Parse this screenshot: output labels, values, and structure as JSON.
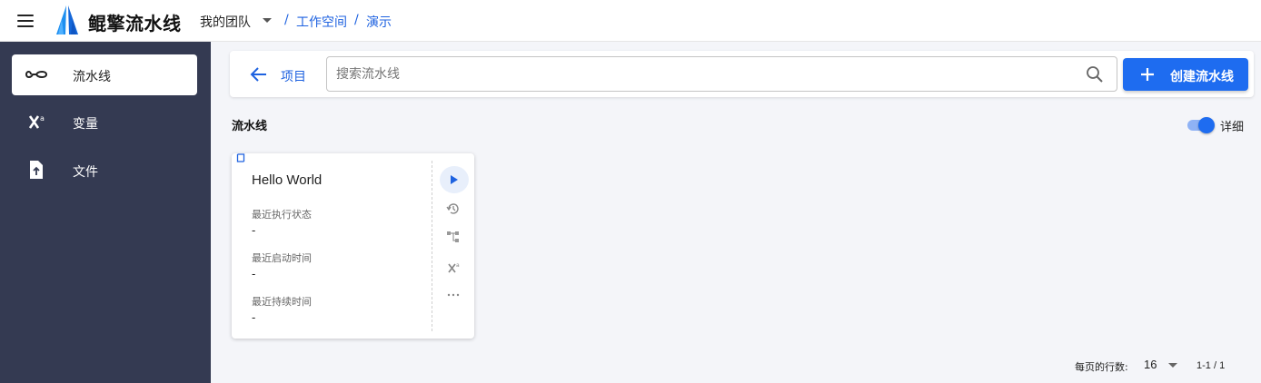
{
  "header": {
    "app_title": "鲲擎流水线",
    "team": "我的团队",
    "breadcrumb": [
      {
        "sep": "/",
        "label": "工作空间"
      },
      {
        "sep": "/",
        "label": "演示"
      }
    ]
  },
  "sidebar": {
    "items": [
      {
        "label": "流水线",
        "icon": "infinity-icon",
        "active": true
      },
      {
        "label": "变量",
        "icon": "variable-icon",
        "active": false
      },
      {
        "label": "文件",
        "icon": "file-upload-icon",
        "active": false
      }
    ]
  },
  "toolbar": {
    "back_label": "项目",
    "search_placeholder": "搜索流水线",
    "search_value": "",
    "create_label": "创建流水线"
  },
  "section": {
    "title": "流水线",
    "detail_toggle_label": "详细",
    "detail_toggle_on": true
  },
  "pipelines": [
    {
      "title": "Hello World",
      "fields": [
        {
          "label": "最近执行状态",
          "value": "-"
        },
        {
          "label": "最近启动时间",
          "value": "-"
        },
        {
          "label": "最近持续时间",
          "value": "-"
        }
      ],
      "actions": [
        "play-icon",
        "history-icon",
        "tree-icon",
        "variable-icon",
        "more-icon"
      ]
    }
  ],
  "pagination": {
    "rows_per_page_label": "每页的行数:",
    "rows_per_page": "16",
    "range": "1-1 / 1"
  },
  "colors": {
    "primary": "#1e6cf0",
    "link": "#1e62e0",
    "sidebar_bg": "#343a52",
    "page_bg": "#f4f5f9"
  }
}
